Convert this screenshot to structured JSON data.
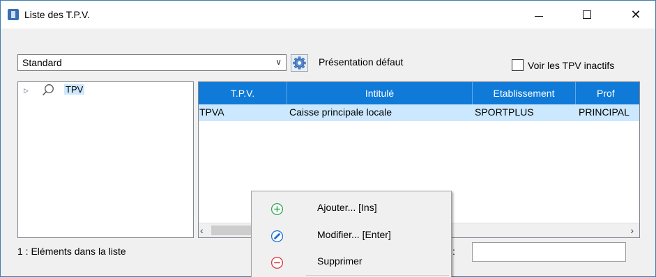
{
  "window": {
    "title": "Liste des T.P.V.",
    "minimize": "minimize",
    "maximize": "maximize",
    "close": "✕"
  },
  "toolbar": {
    "presentation_value": "Standard",
    "presentation_button_label": "Présentation défaut",
    "inactive_checkbox_label": "Voir les TPV inactifs",
    "inactive_checked": false
  },
  "tree": {
    "root_label": "TPV"
  },
  "grid": {
    "columns": [
      "T.P.V.",
      "Intitulé",
      "Etablissement",
      "Prof"
    ],
    "rows": [
      [
        "TPVA",
        "Caisse principale locale",
        "SPORTPLUS",
        "PRINCIPAL"
      ]
    ]
  },
  "status": {
    "count_text": "1 : Eléments dans la liste",
    "field_colon": ":"
  },
  "context_menu": {
    "items": [
      {
        "label": "Ajouter... [Ins]",
        "icon": "add-circle-icon"
      },
      {
        "label": "Modifier... [Enter]",
        "icon": "edit-icon"
      },
      {
        "label": "Supprimer",
        "icon": "remove-circle-icon"
      }
    ]
  },
  "colors": {
    "header_blue": "#0f7ad8",
    "selection": "#cce8ff",
    "add_green": "#2fa84f",
    "edit_blue": "#1e6fd0",
    "delete_red": "#d9363e"
  }
}
